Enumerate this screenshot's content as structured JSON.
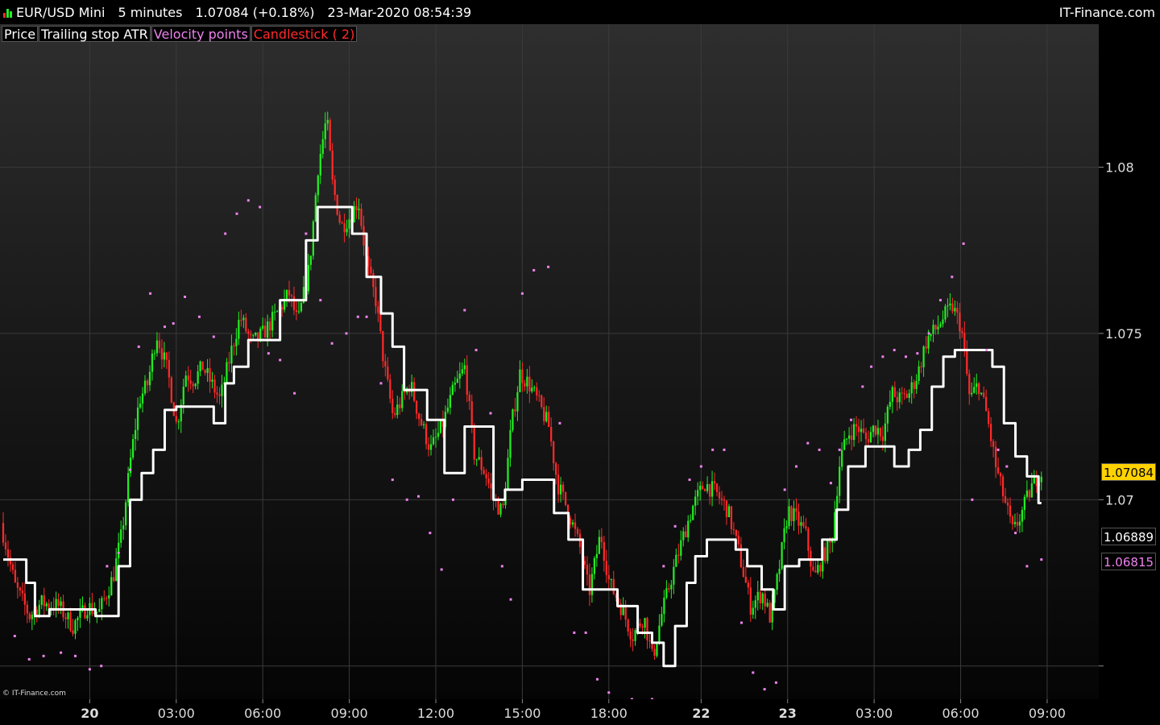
{
  "header": {
    "instrument": "EUR/USD Mini",
    "timeframe": "5 minutes",
    "last_quote": "1.07084 (+0.18%)",
    "datetime": "23-Mar-2020 08:54:39",
    "brand": "IT-Finance.com"
  },
  "indicators": [
    {
      "label": "Price",
      "color": "#ffffff"
    },
    {
      "label": "Trailing stop ATR",
      "color": "#ffffff"
    },
    {
      "label": "Velocity points",
      "color": "#ee82ee"
    },
    {
      "label": "Candlestick ( 2)",
      "color": "#ff2a2a"
    }
  ],
  "copyright": "© IT-Finance.com",
  "colors": {
    "bull": "#22ee22",
    "bear": "#ff2a2a",
    "trailing": "#ffffff",
    "velocity": "#ee82ee",
    "price_tag_bg": "#ffd200",
    "grid": "#3a3a3a"
  },
  "chart_data": {
    "type": "candlestick",
    "y_range": [
      1.064,
      1.0843
    ],
    "y_ticks": [
      {
        "value": 1.065,
        "label": ""
      },
      {
        "value": 1.07,
        "label": "1.07"
      },
      {
        "value": 1.075,
        "label": "1.075"
      },
      {
        "value": 1.08,
        "label": "1.08"
      }
    ],
    "x_ticks": [
      {
        "label": "20",
        "bold": true,
        "hour": 0
      },
      {
        "label": "03:00",
        "bold": false,
        "hour": 3
      },
      {
        "label": "06:00",
        "bold": false,
        "hour": 6
      },
      {
        "label": "09:00",
        "bold": false,
        "hour": 9
      },
      {
        "label": "12:00",
        "bold": false,
        "hour": 12
      },
      {
        "label": "15:00",
        "bold": false,
        "hour": 15
      },
      {
        "label": "18:00",
        "bold": false,
        "hour": 18
      },
      {
        "label": "22",
        "bold": true,
        "hour": 21.2
      },
      {
        "label": "23",
        "bold": true,
        "hour": 24.2
      },
      {
        "label": "03:00",
        "bold": false,
        "hour": 27.2
      },
      {
        "label": "06:00",
        "bold": false,
        "hour": 30.2
      },
      {
        "label": "09:00",
        "bold": false,
        "hour": 33.2
      }
    ],
    "time_range_hours": [
      -3,
      33.9
    ],
    "price_path": [
      [
        -3,
        1.0693
      ],
      [
        -2.5,
        1.0674
      ],
      [
        -2.0,
        1.0665
      ],
      [
        -1.6,
        1.0669
      ],
      [
        -1.0,
        1.0668
      ],
      [
        -0.5,
        1.0662
      ],
      [
        0,
        1.0668
      ],
      [
        0.4,
        1.0666
      ],
      [
        0.9,
        1.0677
      ],
      [
        1.2,
        1.069
      ],
      [
        1.5,
        1.0712
      ],
      [
        1.8,
        1.073
      ],
      [
        2.1,
        1.0735
      ],
      [
        2.4,
        1.075
      ],
      [
        2.8,
        1.0738
      ],
      [
        3.1,
        1.0722
      ],
      [
        3.4,
        1.0738
      ],
      [
        3.7,
        1.0736
      ],
      [
        4.0,
        1.074
      ],
      [
        4.3,
        1.0735
      ],
      [
        4.6,
        1.073
      ],
      [
        5.0,
        1.0745
      ],
      [
        5.3,
        1.0755
      ],
      [
        5.7,
        1.0747
      ],
      [
        6.1,
        1.075
      ],
      [
        6.5,
        1.0755
      ],
      [
        7.0,
        1.0762
      ],
      [
        7.3,
        1.0753
      ],
      [
        7.7,
        1.077
      ],
      [
        8.0,
        1.08
      ],
      [
        8.3,
        1.0815
      ],
      [
        8.5,
        1.0795
      ],
      [
        8.8,
        1.0782
      ],
      [
        9.1,
        1.0785
      ],
      [
        9.4,
        1.079
      ],
      [
        9.7,
        1.077
      ],
      [
        10.0,
        1.076
      ],
      [
        10.3,
        1.074
      ],
      [
        10.6,
        1.0725
      ],
      [
        10.9,
        1.073
      ],
      [
        11.2,
        1.0735
      ],
      [
        11.5,
        1.0725
      ],
      [
        11.9,
        1.0715
      ],
      [
        12.3,
        1.0722
      ],
      [
        12.7,
        1.0733
      ],
      [
        13.1,
        1.074
      ],
      [
        13.4,
        1.0714
      ],
      [
        13.8,
        1.0708
      ],
      [
        14.1,
        1.07
      ],
      [
        14.4,
        1.0696
      ],
      [
        14.7,
        1.0722
      ],
      [
        15.0,
        1.0738
      ],
      [
        15.3,
        1.0735
      ],
      [
        15.6,
        1.073
      ],
      [
        16.0,
        1.0722
      ],
      [
        16.3,
        1.0705
      ],
      [
        16.7,
        1.0696
      ],
      [
        17.1,
        1.0685
      ],
      [
        17.4,
        1.0672
      ],
      [
        17.8,
        1.069
      ],
      [
        18.1,
        1.0675
      ],
      [
        18.5,
        1.0668
      ],
      [
        18.9,
        1.0659
      ],
      [
        19.3,
        1.0665
      ],
      [
        19.6,
        1.0652
      ],
      [
        19.9,
        1.0665
      ],
      [
        20.3,
        1.0678
      ],
      [
        20.7,
        1.069
      ],
      [
        21.0,
        1.0698
      ],
      [
        21.4,
        1.0705
      ],
      [
        21.8,
        1.0702
      ],
      [
        22.2,
        1.0697
      ],
      [
        22.6,
        1.0684
      ],
      [
        23.0,
        1.0668
      ],
      [
        23.4,
        1.0672
      ],
      [
        23.7,
        1.0664
      ],
      [
        24.0,
        1.068
      ],
      [
        24.3,
        1.0697
      ],
      [
        24.6,
        1.0694
      ],
      [
        24.9,
        1.069
      ],
      [
        25.2,
        1.0676
      ],
      [
        25.5,
        1.0683
      ],
      [
        25.8,
        1.0687
      ],
      [
        26.1,
        1.0712
      ],
      [
        26.4,
        1.072
      ],
      [
        26.7,
        1.0722
      ],
      [
        27.0,
        1.0718
      ],
      [
        27.3,
        1.0722
      ],
      [
        27.6,
        1.072
      ],
      [
        27.9,
        1.0732
      ],
      [
        28.2,
        1.073
      ],
      [
        28.5,
        1.0732
      ],
      [
        28.8,
        1.0738
      ],
      [
        29.1,
        1.0748
      ],
      [
        29.4,
        1.0751
      ],
      [
        29.7,
        1.0755
      ],
      [
        30.0,
        1.0758
      ],
      [
        30.3,
        1.0752
      ],
      [
        30.6,
        1.073
      ],
      [
        30.9,
        1.0735
      ],
      [
        31.2,
        1.0725
      ],
      [
        31.5,
        1.071
      ],
      [
        31.8,
        1.07
      ],
      [
        32.1,
        1.069
      ],
      [
        32.4,
        1.0696
      ],
      [
        32.7,
        1.0703
      ],
      [
        33.0,
        1.0708
      ]
    ],
    "trailing_stop_steps": [
      [
        -3,
        1.0682
      ],
      [
        -2.2,
        1.0675
      ],
      [
        -1.9,
        1.0665
      ],
      [
        -1.4,
        1.0667
      ],
      [
        0.2,
        1.0665
      ],
      [
        1.0,
        1.068
      ],
      [
        1.4,
        1.07
      ],
      [
        1.8,
        1.0708
      ],
      [
        2.2,
        1.0715
      ],
      [
        2.6,
        1.0727
      ],
      [
        3.0,
        1.0728
      ],
      [
        4.3,
        1.0723
      ],
      [
        4.7,
        1.0735
      ],
      [
        5.0,
        1.074
      ],
      [
        5.5,
        1.0748
      ],
      [
        6.6,
        1.076
      ],
      [
        7.5,
        1.0778
      ],
      [
        7.9,
        1.0788
      ],
      [
        9.1,
        1.078
      ],
      [
        9.6,
        1.0767
      ],
      [
        10.1,
        1.0756
      ],
      [
        10.5,
        1.0746
      ],
      [
        10.9,
        1.0733
      ],
      [
        11.7,
        1.0724
      ],
      [
        12.3,
        1.0708
      ],
      [
        13.0,
        1.0722
      ],
      [
        14.0,
        1.07
      ],
      [
        14.4,
        1.0703
      ],
      [
        15.0,
        1.0706
      ],
      [
        16.1,
        1.0696
      ],
      [
        16.6,
        1.0688
      ],
      [
        17.1,
        1.0673
      ],
      [
        18.3,
        1.0668
      ],
      [
        19.0,
        1.066
      ],
      [
        19.5,
        1.0657
      ],
      [
        19.9,
        1.065
      ],
      [
        20.3,
        1.0662
      ],
      [
        20.7,
        1.0675
      ],
      [
        21.0,
        1.0683
      ],
      [
        21.4,
        1.0688
      ],
      [
        22.4,
        1.0685
      ],
      [
        22.8,
        1.068
      ],
      [
        23.3,
        1.0673
      ],
      [
        23.7,
        1.0667
      ],
      [
        24.1,
        1.068
      ],
      [
        24.6,
        1.0682
      ],
      [
        25.4,
        1.0688
      ],
      [
        25.9,
        1.0697
      ],
      [
        26.3,
        1.071
      ],
      [
        26.9,
        1.0716
      ],
      [
        27.9,
        1.071
      ],
      [
        28.4,
        1.0715
      ],
      [
        28.8,
        1.0721
      ],
      [
        29.2,
        1.0734
      ],
      [
        29.6,
        1.0743
      ],
      [
        30.0,
        1.0745
      ],
      [
        31.3,
        1.074
      ],
      [
        31.7,
        1.0723
      ],
      [
        32.1,
        1.0713
      ],
      [
        32.5,
        1.0707
      ],
      [
        32.9,
        1.0699
      ]
    ],
    "velocity_points": [
      [
        -2.6,
        1.0659
      ],
      [
        -2.1,
        1.0652
      ],
      [
        -1.6,
        1.0653
      ],
      [
        -1.0,
        1.0654
      ],
      [
        -0.5,
        1.0653
      ],
      [
        0.0,
        1.0649
      ],
      [
        0.4,
        1.065
      ],
      [
        0.6,
        1.068
      ],
      [
        1.0,
        1.0684
      ],
      [
        1.4,
        1.0709
      ],
      [
        1.7,
        1.0746
      ],
      [
        2.1,
        1.0762
      ],
      [
        2.6,
        1.0752
      ],
      [
        2.9,
        1.0753
      ],
      [
        3.3,
        1.0761
      ],
      [
        3.8,
        1.0755
      ],
      [
        4.3,
        1.0749
      ],
      [
        4.7,
        1.078
      ],
      [
        5.1,
        1.0786
      ],
      [
        5.5,
        1.079
      ],
      [
        5.9,
        1.0788
      ],
      [
        6.2,
        1.0744
      ],
      [
        6.6,
        1.0742
      ],
      [
        7.1,
        1.0732
      ],
      [
        7.5,
        1.078
      ],
      [
        8.0,
        1.076
      ],
      [
        8.4,
        1.0747
      ],
      [
        8.9,
        1.075
      ],
      [
        9.3,
        1.0755
      ],
      [
        9.6,
        1.0755
      ],
      [
        10.1,
        1.0735
      ],
      [
        10.5,
        1.0706
      ],
      [
        11.0,
        1.07
      ],
      [
        11.4,
        1.0701
      ],
      [
        11.8,
        1.069
      ],
      [
        12.2,
        1.0679
      ],
      [
        12.6,
        1.07
      ],
      [
        13.0,
        1.0757
      ],
      [
        13.4,
        1.0745
      ],
      [
        13.9,
        1.0726
      ],
      [
        14.3,
        1.068
      ],
      [
        14.6,
        1.067
      ],
      [
        15.0,
        1.0762
      ],
      [
        15.4,
        1.0769
      ],
      [
        15.9,
        1.077
      ],
      [
        16.3,
        1.0723
      ],
      [
        16.8,
        1.066
      ],
      [
        17.2,
        1.066
      ],
      [
        17.6,
        1.0646
      ],
      [
        18.0,
        1.0642
      ],
      [
        18.4,
        1.063
      ],
      [
        18.8,
        1.064
      ],
      [
        19.2,
        1.0626
      ],
      [
        19.5,
        1.064
      ],
      [
        19.9,
        1.068
      ],
      [
        20.3,
        1.0692
      ],
      [
        20.8,
        1.0706
      ],
      [
        21.2,
        1.071
      ],
      [
        21.6,
        1.0715
      ],
      [
        22.0,
        1.0715
      ],
      [
        22.6,
        1.0663
      ],
      [
        23.0,
        1.0648
      ],
      [
        23.4,
        1.0643
      ],
      [
        23.8,
        1.0645
      ],
      [
        24.1,
        1.0703
      ],
      [
        24.5,
        1.071
      ],
      [
        24.9,
        1.0717
      ],
      [
        25.3,
        1.0715
      ],
      [
        25.7,
        1.0705
      ],
      [
        26.0,
        1.0715
      ],
      [
        26.4,
        1.0724
      ],
      [
        26.8,
        1.0734
      ],
      [
        27.1,
        1.074
      ],
      [
        27.5,
        1.0743
      ],
      [
        27.9,
        1.0745
      ],
      [
        28.3,
        1.0743
      ],
      [
        28.7,
        1.0744
      ],
      [
        29.1,
        1.075
      ],
      [
        29.5,
        1.076
      ],
      [
        29.9,
        1.0767
      ],
      [
        30.3,
        1.0777
      ],
      [
        30.6,
        1.07
      ],
      [
        31.1,
        1.0745
      ],
      [
        31.5,
        1.0715
      ],
      [
        31.8,
        1.071
      ],
      [
        32.1,
        1.069
      ],
      [
        32.5,
        1.068
      ],
      [
        33.0,
        1.0682
      ]
    ],
    "price_tags": [
      {
        "value": 1.07084,
        "label": "1.07084",
        "bg": "#ffd200",
        "fg": "#000000"
      },
      {
        "value": 1.06889,
        "label": "1.06889",
        "bg": "#000000",
        "fg": "#ffffff"
      },
      {
        "value": 1.06815,
        "label": "1.06815",
        "bg": "#000000",
        "fg": "#ee82ee"
      }
    ]
  }
}
